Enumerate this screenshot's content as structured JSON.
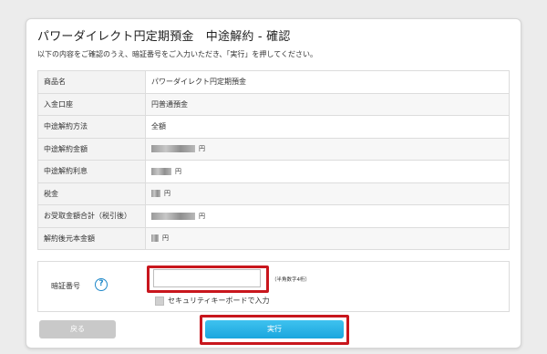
{
  "page": {
    "title": "パワーダイレクト円定期預金　中途解約 - 確認",
    "lead": "以下の内容をご確認のうえ、暗証番号をご入力いただき、「実行」を押してください。"
  },
  "details": {
    "rows": [
      {
        "label": "商品名",
        "value": "パワーダイレクト円定期預金"
      },
      {
        "label": "入金口座",
        "value": "円普通預金"
      },
      {
        "label": "中途解約方法",
        "value": "全額"
      },
      {
        "label": "中途解約金額",
        "value": "円"
      },
      {
        "label": "中途解約利息",
        "value": "円"
      },
      {
        "label": "税金",
        "value": "円"
      },
      {
        "label": "お受取金額合計（税引後）",
        "value": "円"
      },
      {
        "label": "解約後元本金額",
        "value": "円"
      }
    ]
  },
  "pin": {
    "label": "暗証番号",
    "help_glyph": "?",
    "value": "",
    "note": "（半角数字4桁）",
    "keyboard_label": "セキュリティキーボードで入力"
  },
  "buttons": {
    "back": "戻る",
    "execute": "実行"
  },
  "colors": {
    "highlight": "#c8161d",
    "execute": "#1aa6de",
    "help": "#1e88c9"
  },
  "icons": {
    "help": "question-circle-icon"
  }
}
